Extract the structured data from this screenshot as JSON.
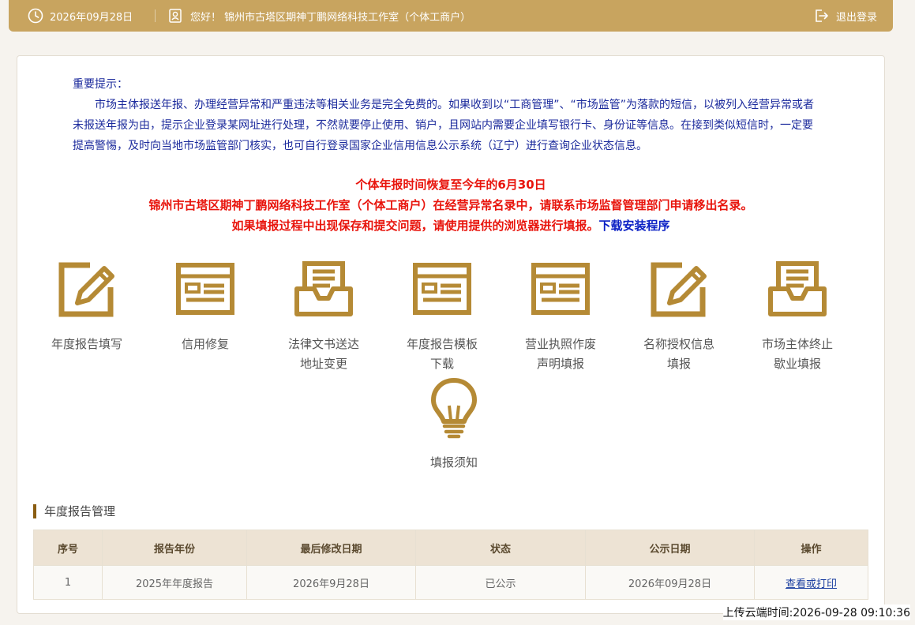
{
  "topbar": {
    "date": "2026年09月28日",
    "greeting": "您好！ 锦州市古塔区期神丁鹏网络科技工作室（个体工商户）",
    "logout_label": "退出登录"
  },
  "notice": {
    "title": "重要提示：",
    "body": "市场主体报送年报、办理经营异常和严重违法等相关业务是完全免费的。如果收到以“工商管理”、“市场监管”为落款的短信，以被列入经营异常或者未报送年报为由，提示企业登录某网址进行处理，不然就要停止使用、销户，且网站内需要企业填写银行卡、身份证等信息。在接到类似短信时，一定要提高警惕，及时向当地市场监管部门核实，也可自行登录国家企业信用信息公示系统（辽宁）进行查询企业状态信息。"
  },
  "alerts": {
    "line1": "个体年报时间恢复至今年的6月30日",
    "line2": "锦州市古塔区期神丁鹏网络科技工作室（个体工商户）在经营异常名录中，请联系市场监督管理部门申请移出名录。",
    "line3": "如果填报过程中出现保存和提交问题，请使用提供的浏览器进行填报。",
    "download_link": "下载安装程序"
  },
  "tiles": [
    {
      "line1": "年度报告填写",
      "line2": ""
    },
    {
      "line1": "信用修复",
      "line2": ""
    },
    {
      "line1": "法律文书送达",
      "line2": "地址变更"
    },
    {
      "line1": "年度报告模板",
      "line2": "下载"
    },
    {
      "line1": "营业执照作废",
      "line2": "声明填报"
    },
    {
      "line1": "名称授权信息",
      "line2": "填报"
    },
    {
      "line1": "市场主体终止",
      "line2": "歇业填报"
    },
    {
      "line1": "填报须知",
      "line2": ""
    }
  ],
  "section": {
    "title": "年度报告管理"
  },
  "table": {
    "headers": [
      "序号",
      "报告年份",
      "最后修改日期",
      "状态",
      "公示日期",
      "操作"
    ],
    "rows": [
      {
        "idx": "1",
        "year": "2025年年度报告",
        "modified": "2026年9月28日",
        "status": "已公示",
        "pub_date": "2026年09月28日",
        "action": "查看或打印"
      }
    ]
  },
  "upload_time": "上传云端时间:2026-09-28 09:10:36",
  "colors": {
    "gold": "#c8a45f",
    "icon_gold": "#b58a35",
    "alert_red": "#e8140c",
    "notice_blue": "#1b2a9c"
  }
}
